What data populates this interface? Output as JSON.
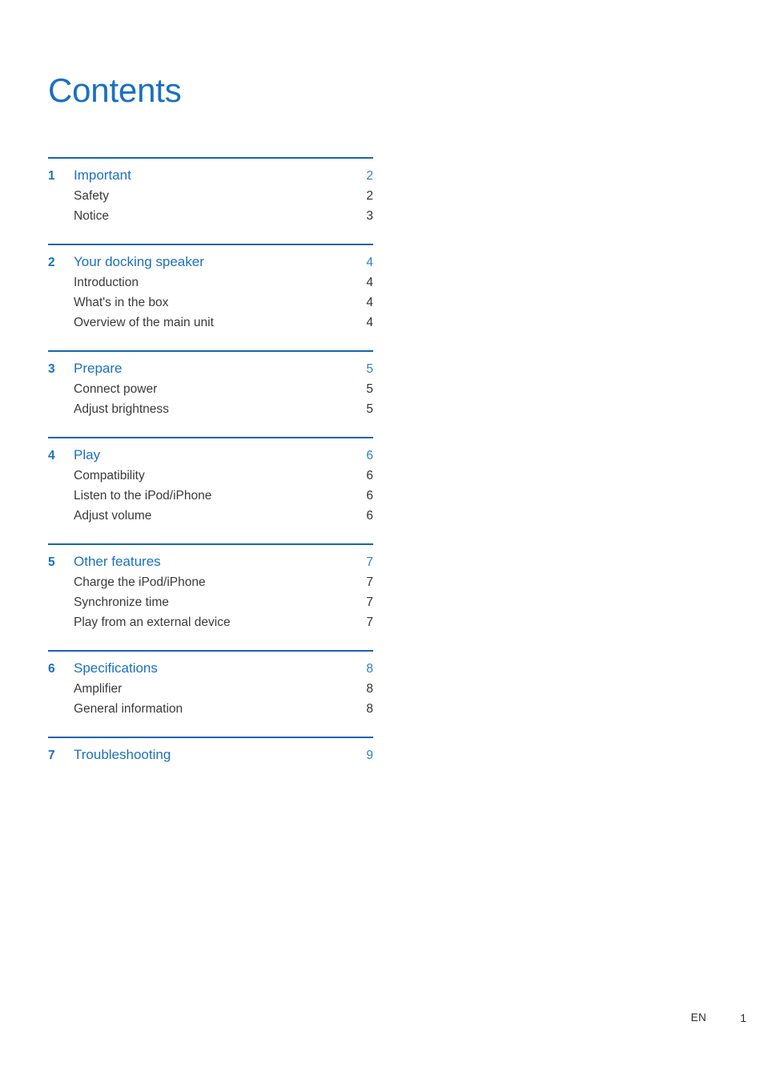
{
  "document": {
    "title": "Contents",
    "accent_color": "#1a70c0",
    "rule_color": "#1565b0",
    "body_text_color": "#3a3a3a"
  },
  "toc": {
    "groups": [
      {
        "number": "1",
        "title": "Important",
        "page": "2",
        "entries": [
          {
            "label": "Safety",
            "page": "2"
          },
          {
            "label": "Notice",
            "page": "3"
          }
        ]
      },
      {
        "number": "2",
        "title": "Your docking speaker",
        "page": "4",
        "entries": [
          {
            "label": "Introduction",
            "page": "4"
          },
          {
            "label": "What's in the box",
            "page": "4"
          },
          {
            "label": "Overview of the main unit",
            "page": "4"
          }
        ]
      },
      {
        "number": "3",
        "title": "Prepare",
        "page": "5",
        "entries": [
          {
            "label": "Connect power",
            "page": "5"
          },
          {
            "label": "Adjust brightness",
            "page": "5"
          }
        ]
      },
      {
        "number": "4",
        "title": "Play",
        "page": "6",
        "entries": [
          {
            "label": "Compatibility",
            "page": "6"
          },
          {
            "label": "Listen to the iPod/iPhone",
            "page": "6"
          },
          {
            "label": "Adjust volume",
            "page": "6"
          }
        ]
      },
      {
        "number": "5",
        "title": "Other features",
        "page": "7",
        "entries": [
          {
            "label": "Charge the iPod/iPhone",
            "page": "7"
          },
          {
            "label": "Synchronize time",
            "page": "7"
          },
          {
            "label": "Play from an external device",
            "page": "7"
          }
        ]
      },
      {
        "number": "6",
        "title": "Specifications",
        "page": "8",
        "entries": [
          {
            "label": "Amplifier",
            "page": "8"
          },
          {
            "label": "General information",
            "page": "8"
          }
        ]
      },
      {
        "number": "7",
        "title": "Troubleshooting",
        "page": "9",
        "entries": []
      }
    ]
  },
  "footer": {
    "language": "EN",
    "page_number": "1"
  }
}
